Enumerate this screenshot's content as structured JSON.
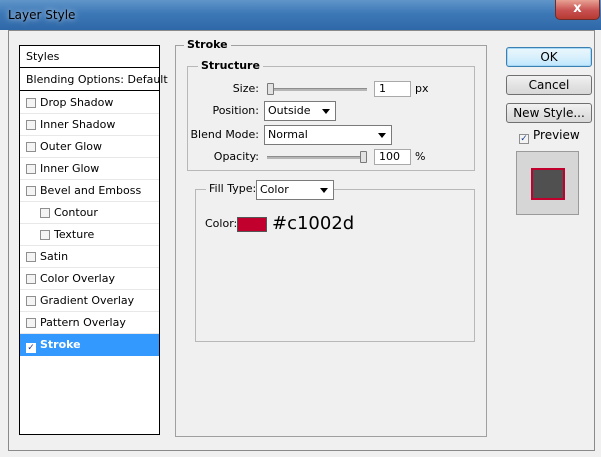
{
  "window": {
    "title": "Layer Style",
    "close_glyph": "x"
  },
  "styles_list": {
    "header": "Styles",
    "blending": "Blending Options: Default",
    "items": [
      {
        "label": "Drop Shadow",
        "checked": false,
        "sub": false
      },
      {
        "label": "Inner Shadow",
        "checked": false,
        "sub": false
      },
      {
        "label": "Outer Glow",
        "checked": false,
        "sub": false
      },
      {
        "label": "Inner Glow",
        "checked": false,
        "sub": false
      },
      {
        "label": "Bevel and Emboss",
        "checked": false,
        "sub": false
      },
      {
        "label": "Contour",
        "checked": false,
        "sub": true
      },
      {
        "label": "Texture",
        "checked": false,
        "sub": true
      },
      {
        "label": "Satin",
        "checked": false,
        "sub": false
      },
      {
        "label": "Color Overlay",
        "checked": false,
        "sub": false
      },
      {
        "label": "Gradient Overlay",
        "checked": false,
        "sub": false
      },
      {
        "label": "Pattern Overlay",
        "checked": false,
        "sub": false
      },
      {
        "label": "Stroke",
        "checked": true,
        "sub": false,
        "selected": true
      }
    ]
  },
  "stroke": {
    "section_title": "Stroke",
    "structure_title": "Structure",
    "size_label": "Size:",
    "size_value": "1",
    "size_unit": "px",
    "size_slider_fraction": 0.0,
    "position_label": "Position:",
    "position_value": "Outside",
    "blend_label": "Blend Mode:",
    "blend_value": "Normal",
    "opacity_label": "Opacity:",
    "opacity_value": "100",
    "opacity_unit": "%",
    "opacity_slider_fraction": 1.0,
    "fill_type_label": "Fill Type:",
    "fill_type_value": "Color",
    "color_label": "Color:",
    "color_hex": "#c1002d"
  },
  "buttons": {
    "ok": "OK",
    "cancel": "Cancel",
    "new_style": "New Style..."
  },
  "preview": {
    "label": "Preview",
    "checked": true,
    "fill_color": "#505050",
    "stroke_color": "#c1002d"
  },
  "icons": {
    "checkbox_checked": "checkmark-icon",
    "dropdown": "chevron-down-icon",
    "close": "close-icon"
  }
}
